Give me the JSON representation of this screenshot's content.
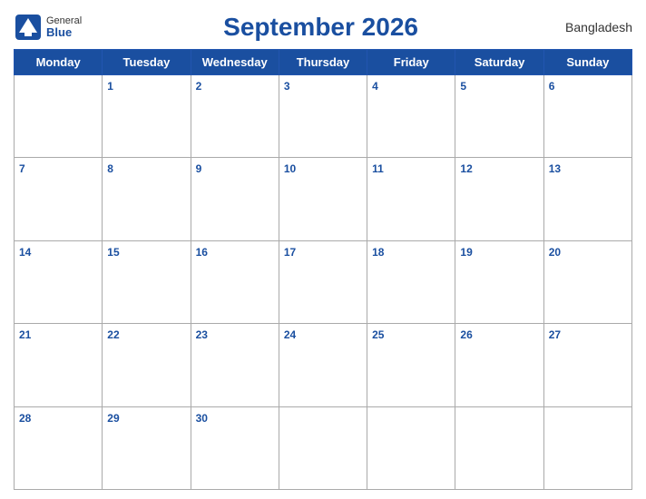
{
  "header": {
    "logo_general": "General",
    "logo_blue": "Blue",
    "title": "September 2026",
    "country": "Bangladesh"
  },
  "days_of_week": [
    "Monday",
    "Tuesday",
    "Wednesday",
    "Thursday",
    "Friday",
    "Saturday",
    "Sunday"
  ],
  "weeks": [
    [
      null,
      1,
      2,
      3,
      4,
      5,
      6
    ],
    [
      7,
      8,
      9,
      10,
      11,
      12,
      13
    ],
    [
      14,
      15,
      16,
      17,
      18,
      19,
      20
    ],
    [
      21,
      22,
      23,
      24,
      25,
      26,
      27
    ],
    [
      28,
      29,
      30,
      null,
      null,
      null,
      null
    ]
  ]
}
